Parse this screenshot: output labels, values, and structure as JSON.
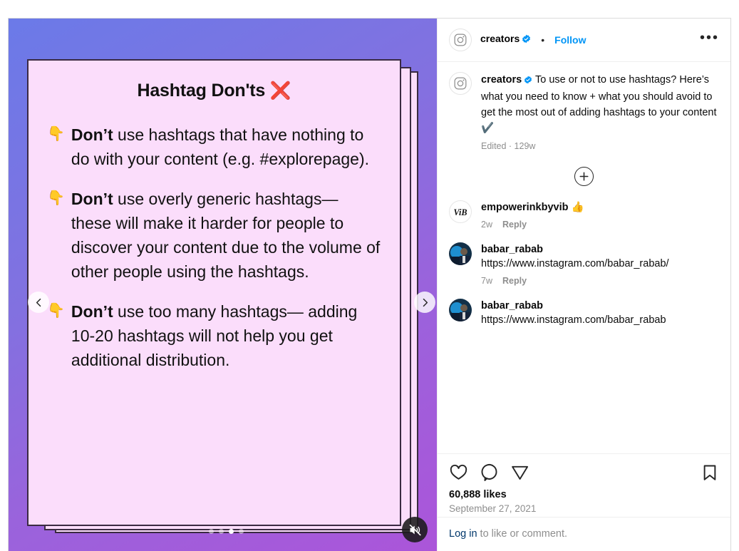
{
  "post": {
    "media": {
      "slide": {
        "title": "Hashtag Don'ts",
        "title_icon": "❌",
        "bullets": [
          {
            "emoji": "👇",
            "lead": "Don’t",
            "text": " use hashtags that have nothing to do with your content (e.g. #explorepage)."
          },
          {
            "emoji": "👇",
            "lead": "Don’t",
            "text": " use overly generic hashtags— these will make it harder for people to discover your content due to the volume of other people using the hashtags."
          },
          {
            "emoji": "👇",
            "lead": "Don’t",
            "text": " use too many hashtags— adding 10-20 hashtags will not help you get additional distribution."
          }
        ]
      },
      "carousel": {
        "total_dots": 4,
        "active_index": 2
      },
      "prev_icon": "chevron-left-icon",
      "next_icon": "chevron-right-icon",
      "mute_icon": "speaker-muted-icon",
      "colors": {
        "bg_top": "#6b7ae8",
        "bg_bottom": "#ab55d9",
        "card": "#fbddfb",
        "card_border": "#3a2a42",
        "xmark": "#e3342f"
      }
    },
    "header": {
      "avatar_icon": "instagram-logo-icon",
      "username": "creators",
      "verified_icon": "verified-badge-icon",
      "separator": "•",
      "follow_label": "Follow",
      "more_label": "•••"
    },
    "caption": {
      "avatar_icon": "instagram-logo-icon",
      "username": "creators",
      "verified_icon": "verified-badge-icon",
      "text": "To use or not to use hashtags? Here’s what you need to know + what you should avoid to get the most out of adding hashtags to your content ✔️",
      "meta": "Edited · 129w"
    },
    "load_more": {
      "icon": "plus-circle-icon"
    },
    "comments": [
      {
        "avatar_icon": "vib-monogram-avatar",
        "username": "empowerinkbyvib",
        "text": " 👍",
        "time": "2w",
        "reply_label": "Reply"
      },
      {
        "avatar_icon": "photo-avatar",
        "username": "babar_rabab",
        "text": "https://www.instagram.com/babar_rabab/",
        "time": "7w",
        "reply_label": "Reply"
      },
      {
        "avatar_icon": "photo-avatar",
        "username": "babar_rabab",
        "text": "https://www.instagram.com/babar_rabab",
        "time": "",
        "reply_label": ""
      }
    ],
    "actions": {
      "like_icon": "heart-icon",
      "comment_icon": "comment-bubble-icon",
      "share_icon": "share-paper-plane-icon",
      "save_icon": "bookmark-icon"
    },
    "likes": "60,888 likes",
    "date": "September 27, 2021",
    "login": {
      "link_label": "Log in",
      "rest": " to like or comment."
    }
  }
}
